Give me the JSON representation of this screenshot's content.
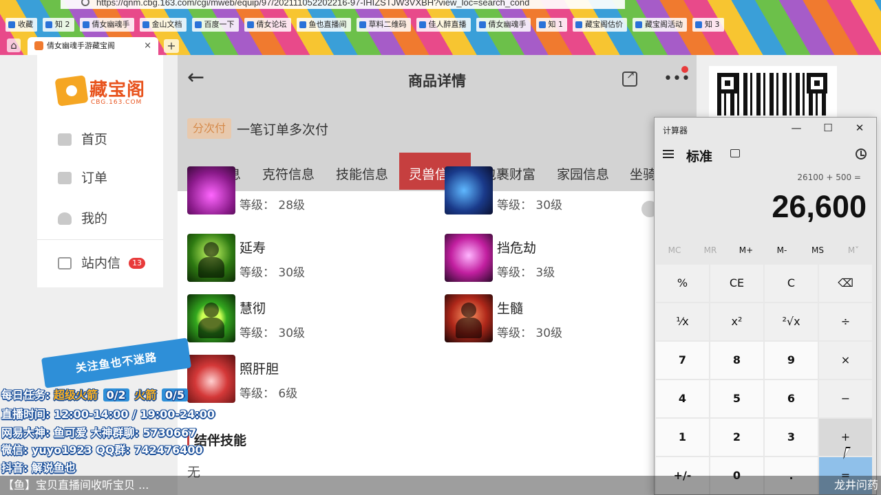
{
  "browser": {
    "url": "https://qnm.cbg.163.com/cgi/mweb/equip/97/202111052202216-97-IHIZSTJW3VXBH?view_loc=search_cond",
    "bookmarks": [
      "收藏",
      "知 2",
      "倩女幽魂手",
      "金山文档",
      "百度一下",
      "倩女论坛",
      "鱼也直播间",
      "草料二维码",
      "佳人醉直播",
      "倩女幽魂手",
      "知 1",
      "藏宝阁估价",
      "藏宝阁活动",
      "知 3"
    ],
    "tab_title": "倩女幽魂手游藏宝阁",
    "tab_close": "×",
    "new_tab": "+"
  },
  "sidebar": {
    "logo_text": "藏宝阁",
    "logo_sub": "CBG.163.COM",
    "items": [
      {
        "label": "首页",
        "icon": "home-icon"
      },
      {
        "label": "订单",
        "icon": "order-icon"
      },
      {
        "label": "我的",
        "icon": "user-icon"
      },
      {
        "label": "站内信",
        "icon": "mail-icon",
        "badge": "13"
      }
    ]
  },
  "header": {
    "back": "←",
    "title": "商品详情",
    "more": "•••"
  },
  "payment": {
    "tag": "分次付",
    "text": "一笔订单多次付"
  },
  "tabs": [
    {
      "label": "装备信息",
      "active": false
    },
    {
      "label": "克符信息",
      "active": false
    },
    {
      "label": "技能信息",
      "active": false
    },
    {
      "label": "灵兽信息",
      "active": true
    },
    {
      "label": "包裹财富",
      "active": false
    },
    {
      "label": "家园信息",
      "active": false
    },
    {
      "label": "坐骑",
      "active": false
    }
  ],
  "skills": [
    {
      "name": "",
      "level": "等级： 28级"
    },
    {
      "name": "",
      "level": "等级： 30级"
    },
    {
      "name": "延寿",
      "level": "等级： 30级"
    },
    {
      "name": "挡危劫",
      "level": "等级： 3级"
    },
    {
      "name": "慧彻",
      "level": "等级： 30级"
    },
    {
      "name": "生髓",
      "level": "等级： 30级"
    },
    {
      "name": "照肝胆",
      "level": "等级： 6级"
    }
  ],
  "bond": {
    "title": "结伴技能",
    "value": "无"
  },
  "calculator": {
    "window_title": "计算器",
    "minimize": "—",
    "maximize": "☐",
    "close": "✕",
    "mode": "标准",
    "expression": "26100 + 500 =",
    "display": "26,600",
    "memory": [
      "MC",
      "MR",
      "M+",
      "M-",
      "MS",
      "M˅"
    ],
    "keys": [
      [
        "%",
        "CE",
        "C",
        "⌫"
      ],
      [
        "¹⁄x",
        "x²",
        "²√x",
        "÷"
      ],
      [
        "7",
        "8",
        "9",
        "×"
      ],
      [
        "4",
        "5",
        "6",
        "−"
      ],
      [
        "1",
        "2",
        "3",
        "+"
      ],
      [
        "+/-",
        "0",
        ".",
        "="
      ]
    ]
  },
  "overlay": {
    "banner": "关注鱼也不迷路",
    "task_label": "每日任务:",
    "task_a": "超级火箭",
    "task_a_count": "0/2",
    "task_b": "火箭",
    "task_b_count": "0/5",
    "live_time": "直播时间: 12:00-14:00 / 19:00-24:00",
    "netease": "网易大神: 鱼可爱   大神群聊: 5730667",
    "wechat": "微信: yuyo1923   QQ群: 742476400",
    "douyin": "抖音: 解说鱼也",
    "ticker": "【鱼】宝贝直播间收听宝贝 ...",
    "ticker_end": "龙井问药"
  }
}
